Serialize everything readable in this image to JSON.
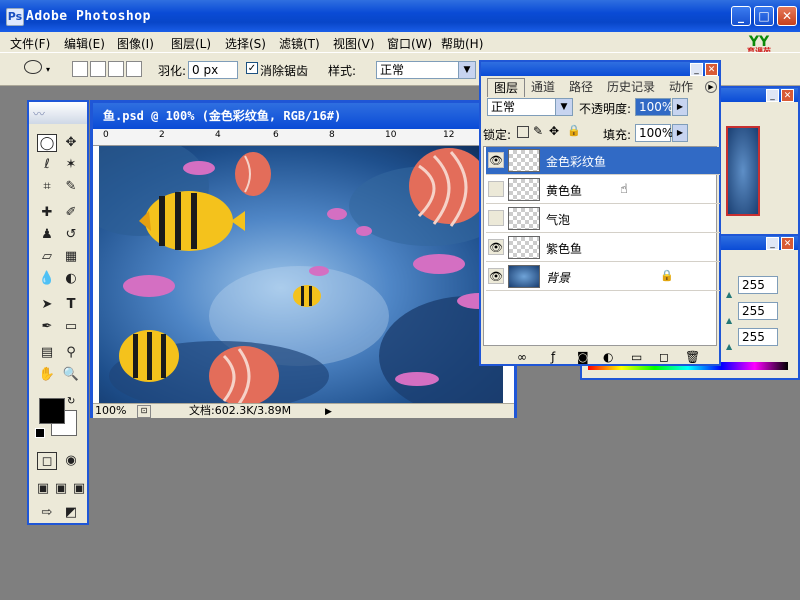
{
  "app": {
    "title": "Adobe Photoshop",
    "logo_text": "YY",
    "logo_sub": "育课苑"
  },
  "menu": [
    "文件(F)",
    "编辑(E)",
    "图像(I)",
    "图层(L)",
    "选择(S)",
    "滤镜(T)",
    "视图(V)",
    "窗口(W)",
    "帮助(H)"
  ],
  "options": {
    "feather_label": "羽化:",
    "feather_value": "0 px",
    "antialias_label": "消除锯齿",
    "style_label": "样式:",
    "style_value": "正常"
  },
  "document": {
    "title": "鱼.psd @ 100% (金色彩纹鱼, RGB/16#)",
    "ruler_ticks": [
      "0",
      "2",
      "4",
      "6",
      "8",
      "10",
      "12"
    ],
    "zoom": "100%",
    "doc_info": "文档:602.3K/3.89M"
  },
  "layers_panel": {
    "tabs": [
      "图层",
      "通道",
      "路径",
      "历史记录",
      "动作"
    ],
    "blend_mode": "正常",
    "opacity_label": "不透明度:",
    "opacity_value": "100%",
    "lock_label": "锁定:",
    "fill_label": "填充:",
    "fill_value": "100%",
    "layers": [
      {
        "name": "金色彩纹鱼",
        "visible": true,
        "selected": true
      },
      {
        "name": "黄色鱼",
        "visible": false,
        "selected": false
      },
      {
        "name": "气泡",
        "visible": false,
        "selected": false
      },
      {
        "name": "紫色鱼",
        "visible": true,
        "selected": false
      },
      {
        "name": "背景",
        "visible": true,
        "selected": false,
        "locked": true
      }
    ]
  },
  "color_panel": {
    "values": [
      "255",
      "255",
      "255"
    ]
  },
  "colors": {
    "xp_blue": "#1f56d6",
    "selected_layer": "#316ac5",
    "panel_bg": "#ece9d8",
    "workspace": "#7f7f7f"
  }
}
